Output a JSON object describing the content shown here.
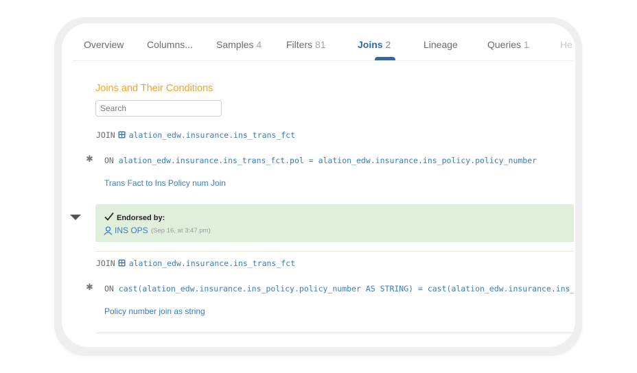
{
  "tabs": [
    {
      "label": "Overview",
      "count": "",
      "active": false
    },
    {
      "label": "Columns...",
      "count": "",
      "active": false
    },
    {
      "label": "Samples",
      "count": "4",
      "active": false
    },
    {
      "label": "Filters",
      "count": "81",
      "active": false
    },
    {
      "label": "Joins",
      "count": "2",
      "active": true
    },
    {
      "label": "Lineage",
      "count": "",
      "active": false
    },
    {
      "label": "Queries",
      "count": "1",
      "active": false
    },
    {
      "label": "He",
      "count": "",
      "active": false
    }
  ],
  "section": {
    "title": "Joins and Their Conditions",
    "search_placeholder": "Search"
  },
  "joins": [
    {
      "keyword": "JOIN",
      "table": "alation_edw.insurance.ins_trans_fct",
      "on_keyword": "ON",
      "condition": "alation_edw.insurance.ins_trans_fct.pol = alation_edw.insurance.ins_policy.policy_number",
      "description": "Trans Fact to Ins Policy num Join"
    },
    {
      "keyword": "JOIN",
      "table": "alation_edw.insurance.ins_trans_fct",
      "on_keyword": "ON",
      "condition": "cast(alation_edw.insurance.ins_policy.policy_number AS STRING) = cast(alation_edw.insurance.ins_policy.policy_number AS STRING)",
      "description": "Policy number join as string"
    }
  ],
  "endorsement": {
    "label": "Endorsed by:",
    "user": "INS OPS",
    "time": "(Sep 16, at 3:47 pm)"
  },
  "colors": {
    "accent": "#2f6aa6",
    "link": "#3a7bc0",
    "section_title": "#f5a623",
    "endorse_bg": "#e0efdb"
  }
}
